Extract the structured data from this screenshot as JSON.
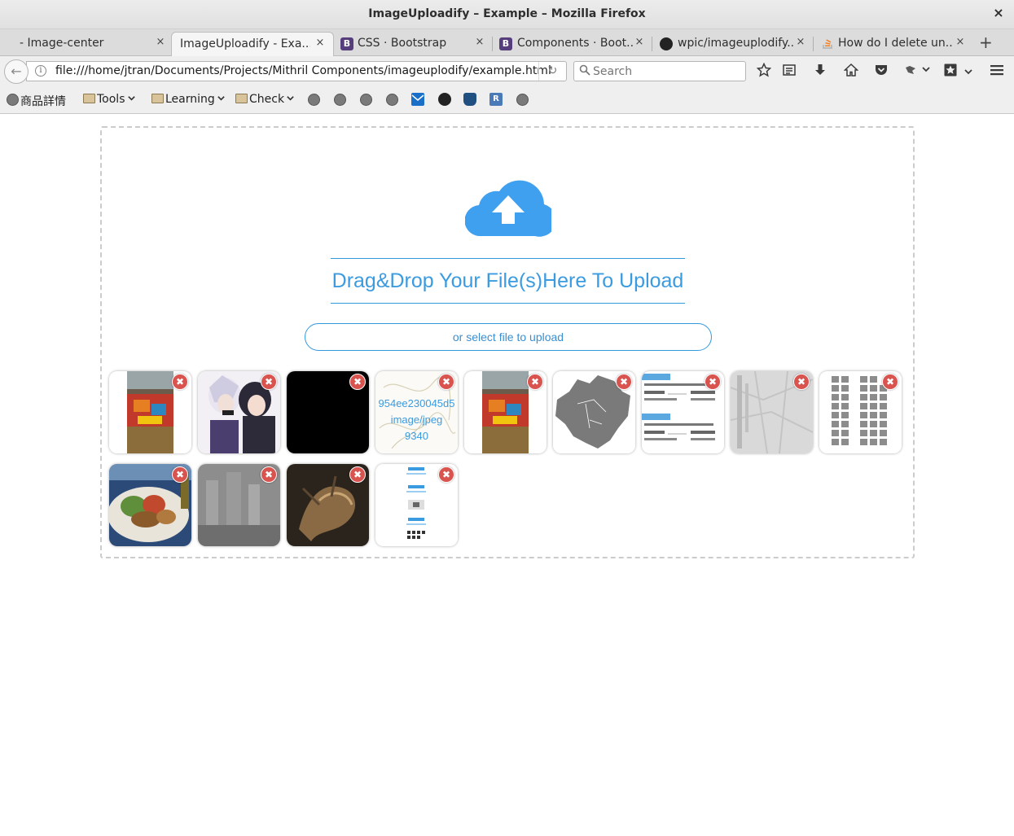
{
  "window": {
    "title": "ImageUploadify – Example – Mozilla Firefox",
    "close_glyph": "×"
  },
  "tabs": [
    {
      "label": "- Image-center",
      "favicon": "none",
      "active": false
    },
    {
      "label": "ImageUploadify - Exa...",
      "favicon": "none",
      "active": true
    },
    {
      "label": "CSS · Bootstrap",
      "favicon": "bootstrap-icon",
      "favicon_text": "B",
      "active": false
    },
    {
      "label": "Components · Boot...",
      "favicon": "bootstrap-icon",
      "favicon_text": "B",
      "active": false
    },
    {
      "label": "wpic/imageuplodify...",
      "favicon": "github-icon",
      "active": false
    },
    {
      "label": "How do I delete un...",
      "favicon": "stackoverflow-icon",
      "active": false
    }
  ],
  "tab_close_glyph": "×",
  "new_tab_glyph": "+",
  "navbar": {
    "back_glyph": "←",
    "info_glyph": "i",
    "url": "file:///home/jtran/Documents/Projects/Mithril Components/imageuplodify/example.html",
    "reload_glyph": "↻",
    "search_placeholder": "Search",
    "search_glyph": "⚲",
    "icons": [
      "star-icon",
      "reading-list-icon",
      "download-icon",
      "home-icon",
      "pocket-icon",
      "extension-icon",
      "extension-dropdown-icon",
      "sync-icon",
      "sync-dropdown-icon",
      "menu-icon"
    ]
  },
  "bookmarks": {
    "first": "商品詳情",
    "folders": [
      "Tools",
      "Learning",
      "Check"
    ],
    "icons": [
      "globe-icon",
      "globe-icon",
      "globe-icon",
      "globe-icon",
      "mail-icon",
      "github-icon",
      "bitbucket-icon",
      "r-icon",
      "globe-icon"
    ],
    "r_label": "R"
  },
  "uploader": {
    "drop_text": "Drag&Drop Your File(s)Here To Upload",
    "select_label": "or select file to upload",
    "accent_color": "#3b9be0",
    "remove_glyph": "✖",
    "thumbnails": [
      {
        "kind": "photo-table-food"
      },
      {
        "kind": "anime-illustration"
      },
      {
        "kind": "black-image"
      },
      {
        "kind": "placeholder",
        "lines": [
          "954ee230045d5",
          "image/jpeg",
          "9340"
        ]
      },
      {
        "kind": "photo-table-food"
      },
      {
        "kind": "china-map"
      },
      {
        "kind": "flight-itinerary"
      },
      {
        "kind": "crumpled-paper"
      },
      {
        "kind": "character-grid"
      },
      {
        "kind": "salad-plate"
      },
      {
        "kind": "foggy-city"
      },
      {
        "kind": "dark-dragon-art"
      },
      {
        "kind": "uploader-screenshot"
      }
    ]
  }
}
